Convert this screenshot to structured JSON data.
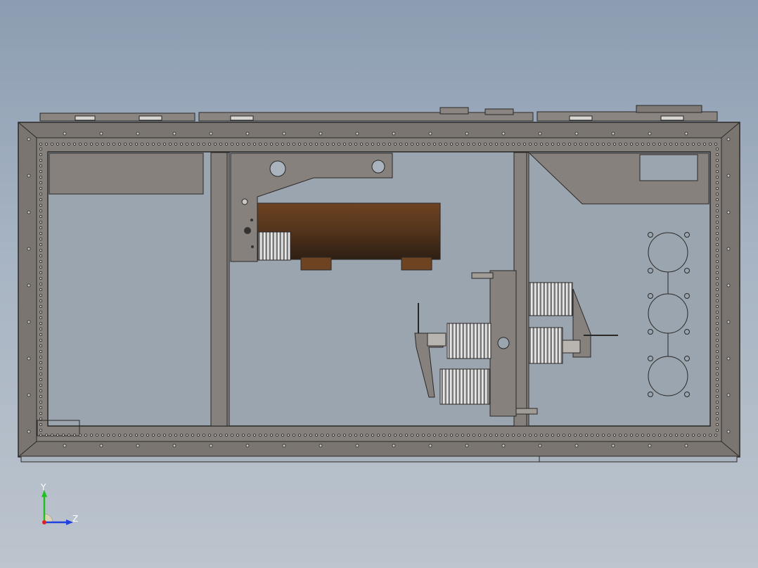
{
  "view": {
    "axes": {
      "y_label": "Y",
      "z_label": "Z"
    },
    "colors": {
      "background_top": "#8c9db1",
      "background_bottom": "#bcc4cd",
      "sheet_metal": "#7a7571",
      "sheet_metal_light": "#8f8a85",
      "edge_line": "#2a2826",
      "panel_fill": "#9ba5af",
      "bushing_brown": "#5a3a1f",
      "axis_x_red": "#e02020",
      "axis_y_green": "#20c020",
      "axis_z_blue": "#2040e0"
    },
    "icons": {
      "triad": "coordinate-triad-icon",
      "insulator": "ribbed-insulator-icon",
      "cylinder": "vacuum-interrupter-icon"
    }
  }
}
